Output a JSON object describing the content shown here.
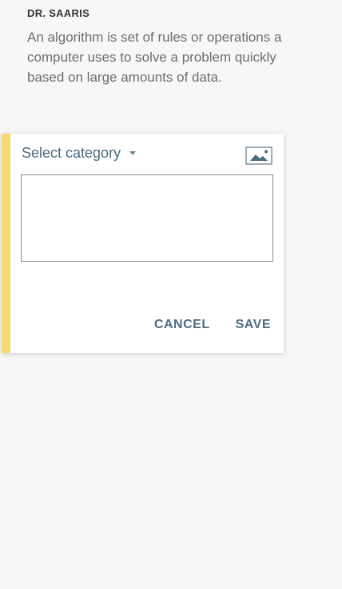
{
  "note": {
    "author": "DR. SAARIS",
    "text": "An algorithm is set of rules or operations a computer uses to solve a problem quickly based on large amounts of data."
  },
  "editor": {
    "category_label": "Select category",
    "input_value": "",
    "cancel_label": "CANCEL",
    "save_label": "SAVE",
    "image_icon": "image-icon",
    "accent_color": "#f7d873",
    "action_color": "#4f6d80"
  }
}
